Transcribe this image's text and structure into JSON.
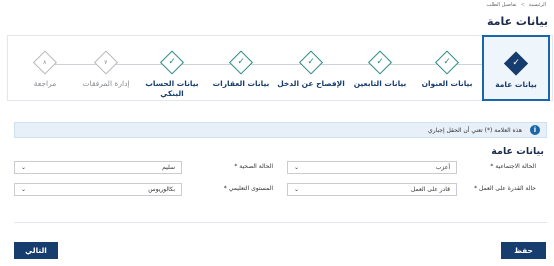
{
  "breadcrumb": [
    "الرئيسية",
    ">",
    "تفاصيل الطلب"
  ],
  "page_title": "بيانات عامة",
  "steps": [
    {
      "label": "بيانات عامة",
      "glyph": "✓",
      "state": "active"
    },
    {
      "label": "بيانات العنوان",
      "glyph": "✓",
      "state": "done"
    },
    {
      "label": "بيانات التابعين",
      "glyph": "✓",
      "state": "done"
    },
    {
      "label": "الإفصاح عن الدخل",
      "glyph": "✓",
      "state": "done"
    },
    {
      "label": "بيانات العقارات",
      "glyph": "✓",
      "state": "done"
    },
    {
      "label": "بيانات الحساب البنكي",
      "glyph": "✓",
      "state": "done"
    },
    {
      "label": "إدارة المرفقات",
      "glyph": "٧",
      "state": "pending"
    },
    {
      "label": "مراجعة",
      "glyph": "٨",
      "state": "pending"
    }
  ],
  "info": {
    "icon": "info-icon",
    "text": "هذه العلامة (*) تعني أن الحقل إجباري"
  },
  "section_title": "بيانات عامة",
  "fields": {
    "marital_status": {
      "label": "الحالة الاجتماعية *",
      "value": "أعزب"
    },
    "health_status": {
      "label": "الحالة الصحية *",
      "value": "سليم"
    },
    "work_ability": {
      "label": "حالة القدرة على العمل *",
      "value": "قادر على العمل"
    },
    "education": {
      "label": "المستوى التعليمي *",
      "value": "بكالوريوس"
    }
  },
  "buttons": {
    "save": "حفظ",
    "next": "التالي"
  },
  "colors": {
    "primary": "#173d6e",
    "accent_green": "#2a8a84",
    "info_bg": "#e7f0f8"
  }
}
